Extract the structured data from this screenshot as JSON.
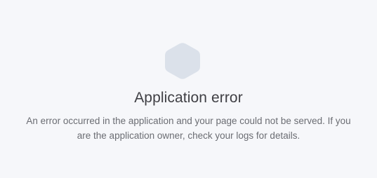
{
  "icon": {
    "name": "hexagon-icon",
    "color": "#dbe1ea"
  },
  "error": {
    "title": "Application error",
    "message": "An error occurred in the application and your page could not be served. If you are the application owner, check your logs for details."
  },
  "colors": {
    "background": "#f6f7fa",
    "title": "#3f3f44",
    "message": "#6b6d73"
  }
}
